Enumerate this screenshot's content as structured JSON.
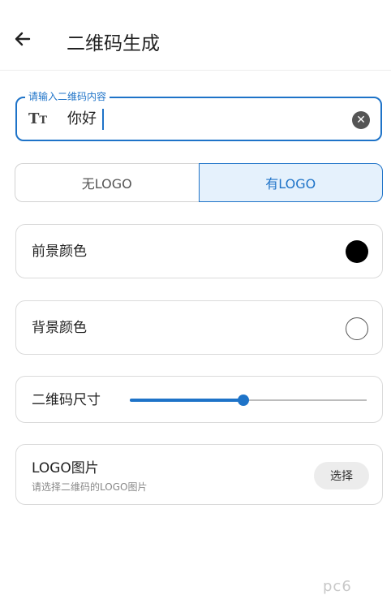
{
  "header": {
    "title": "二维码生成",
    "back_icon": "arrow-left-icon"
  },
  "content_input": {
    "label": "请输入二维码内容",
    "value": "你好",
    "icon": "text-size-icon",
    "icon_text": "T",
    "icon_text_small": "T",
    "clear_icon": "clear-circle-icon"
  },
  "logo_toggle": {
    "options": [
      {
        "label": "无LOGO",
        "selected": false
      },
      {
        "label": "有LOGO",
        "selected": true
      }
    ]
  },
  "foreground_color": {
    "label": "前景颜色",
    "value": "#000000"
  },
  "background_color": {
    "label": "背景颜色",
    "value": "#ffffff"
  },
  "qr_size": {
    "label": "二维码尺寸",
    "value_fraction": 0.48
  },
  "logo_image": {
    "title": "LOGO图片",
    "subtitle": "请选择二维码的LOGO图片",
    "button": "选择"
  },
  "watermark": {
    "text": "pc6"
  },
  "colors": {
    "accent": "#1e73c8",
    "selected_bg": "#e5f1fc"
  }
}
